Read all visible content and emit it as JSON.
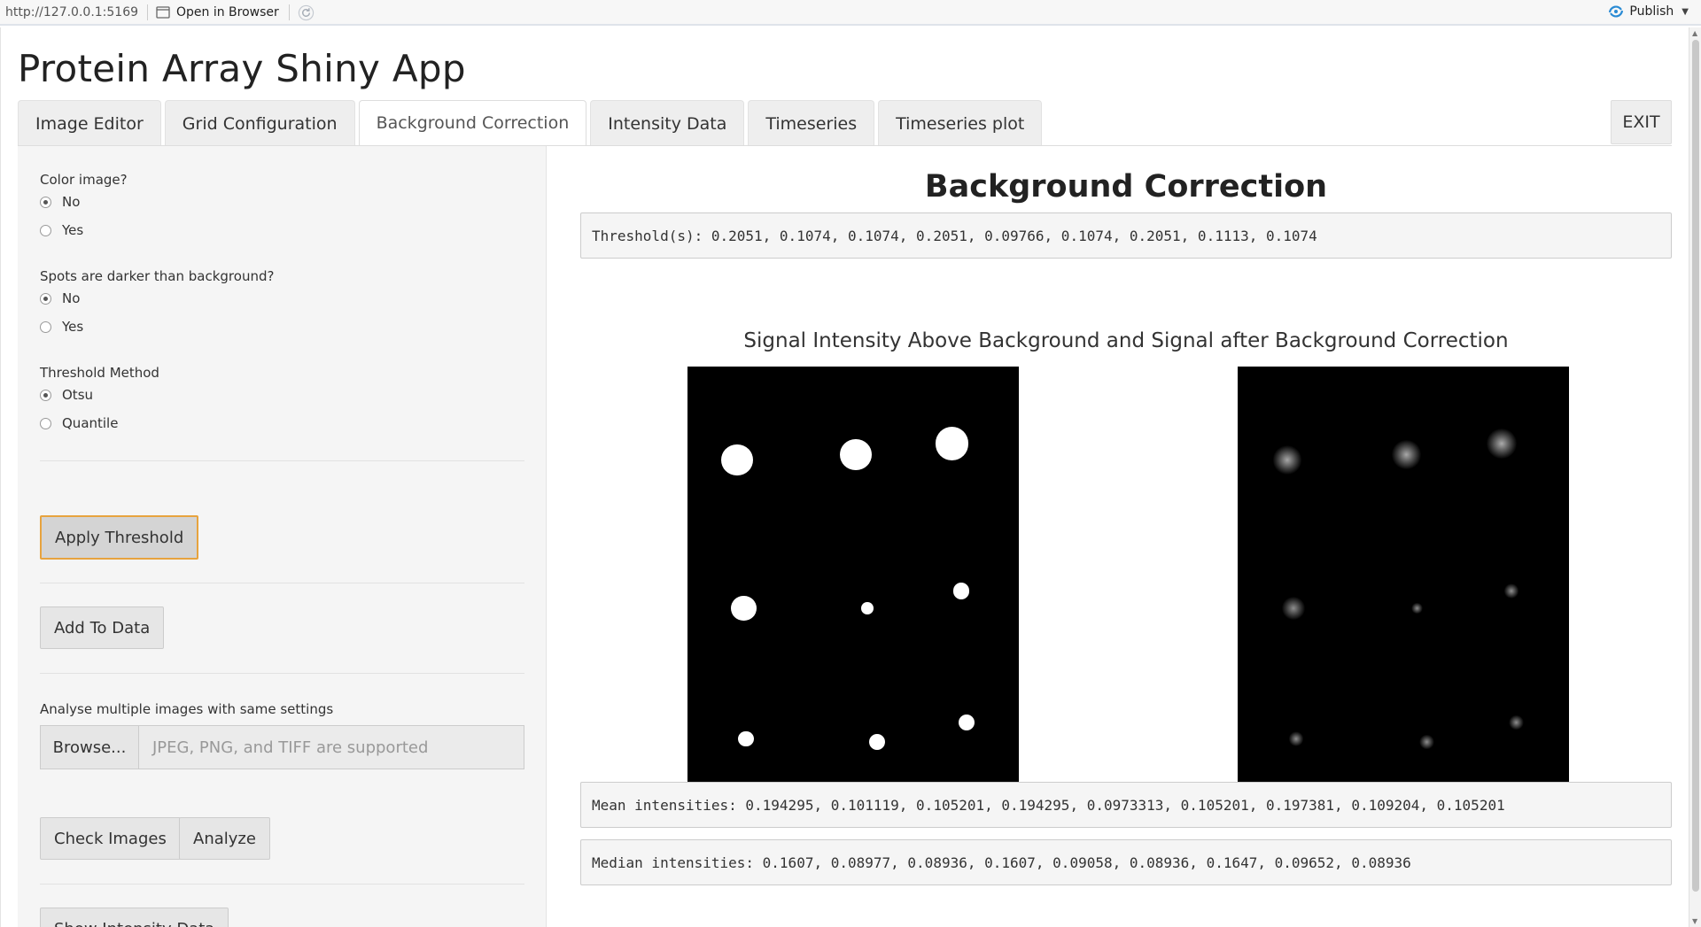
{
  "browser": {
    "url": "http://127.0.0.1:5169",
    "open_label": "Open in Browser",
    "publish_label": "Publish"
  },
  "app": {
    "title": "Protein Array Shiny App"
  },
  "tabs": [
    {
      "label": "Image Editor",
      "active": false
    },
    {
      "label": "Grid Configuration",
      "active": false
    },
    {
      "label": "Background Correction",
      "active": true
    },
    {
      "label": "Intensity Data",
      "active": false
    },
    {
      "label": "Timeseries",
      "active": false
    },
    {
      "label": "Timeseries plot",
      "active": false
    }
  ],
  "exit_label": "EXIT",
  "sidebar": {
    "color_image": {
      "label": "Color image?",
      "options": [
        "No",
        "Yes"
      ],
      "selected": "No"
    },
    "spots_darker": {
      "label": "Spots are darker than background?",
      "options": [
        "No",
        "Yes"
      ],
      "selected": "No"
    },
    "threshold_method": {
      "label": "Threshold Method",
      "options": [
        "Otsu",
        "Quantile"
      ],
      "selected": "Otsu"
    },
    "apply_threshold": "Apply Threshold",
    "add_to_data": "Add To Data",
    "multi_label": "Analyse multiple images with same settings",
    "browse_label": "Browse...",
    "file_placeholder": "JPEG, PNG, and TIFF are supported",
    "check_images": "Check Images",
    "analyze": "Analyze",
    "show_intensity": "Show Intensity Data"
  },
  "main": {
    "title": "Background Correction",
    "thresholds": "Threshold(s): 0.2051, 0.1074, 0.1074, 0.2051, 0.09766, 0.1074, 0.2051, 0.1113, 0.1074",
    "plot_title": "Signal Intensity Above Background and Signal after Background Correction",
    "mean": "Mean intensities: 0.194295, 0.101119, 0.105201, 0.194295, 0.0973313, 0.105201, 0.197381, 0.109204, 0.105201",
    "median": "Median intensities: 0.1607, 0.08977, 0.08936, 0.1607, 0.09058, 0.08936, 0.1647, 0.09652, 0.08936"
  },
  "spots": [
    {
      "fx": 0.149,
      "fy": 0.211,
      "d": 0.096,
      "v": 0.19
    },
    {
      "fx": 0.509,
      "fy": 0.199,
      "d": 0.096,
      "v": 0.19
    },
    {
      "fx": 0.798,
      "fy": 0.174,
      "d": 0.101,
      "v": 0.2
    },
    {
      "fx": 0.169,
      "fy": 0.546,
      "d": 0.077,
      "v": 0.1
    },
    {
      "fx": 0.542,
      "fy": 0.546,
      "d": 0.037,
      "v": 0.1
    },
    {
      "fx": 0.826,
      "fy": 0.507,
      "d": 0.05,
      "v": 0.11
    },
    {
      "fx": 0.176,
      "fy": 0.841,
      "d": 0.048,
      "v": 0.1
    },
    {
      "fx": 0.571,
      "fy": 0.848,
      "d": 0.048,
      "v": 0.1
    },
    {
      "fx": 0.842,
      "fy": 0.804,
      "d": 0.05,
      "v": 0.1
    }
  ]
}
